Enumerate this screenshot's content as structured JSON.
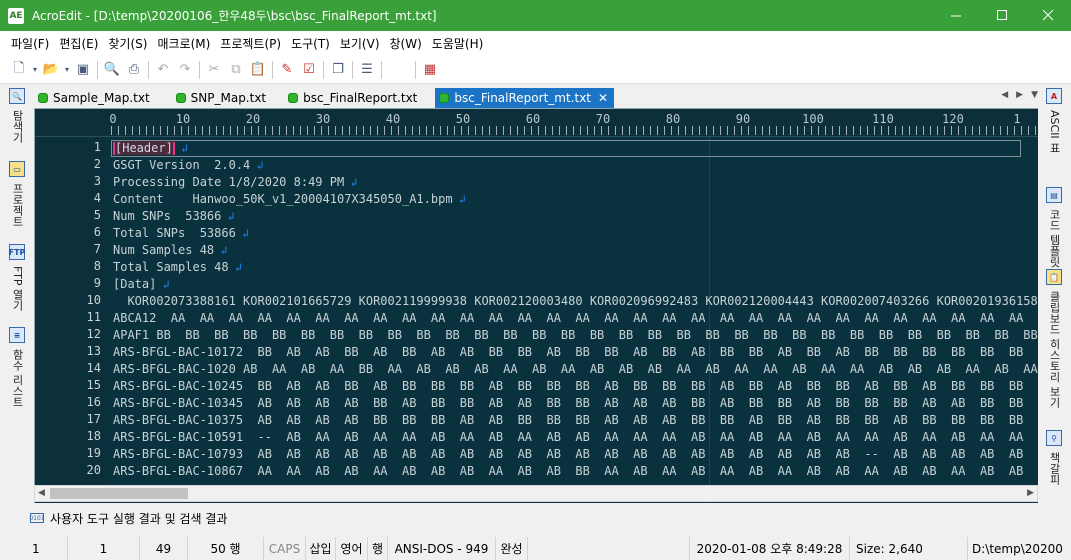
{
  "window": {
    "title": "AcroEdit - [D:\\temp\\20200106_한우48두\\bsc\\bsc_FinalReport_mt.txt]",
    "icon_text": "AE",
    "controls": [
      "minimize-icon",
      "maximize-icon",
      "close-icon"
    ]
  },
  "menu": [
    "파일(F)",
    "편집(E)",
    "찾기(S)",
    "매크로(M)",
    "프로젝트(P)",
    "도구(T)",
    "보기(V)",
    "창(W)",
    "도움말(H)"
  ],
  "toolbar": {
    "icons": [
      "new-file-icon",
      "dropdown-icon",
      "open-folder-icon",
      "dropdown-icon",
      "save-icon",
      "print-preview-icon",
      "print-icon",
      "undo-icon",
      "redo-icon",
      "cut-icon",
      "copy-icon",
      "paste-icon",
      "bookmark-icon",
      "bookmark-list-icon",
      "window-icon",
      "column-mode-icon",
      "calendar-icon"
    ]
  },
  "left_panel": [
    {
      "label": "탐색기",
      "icon": "explorer-icon"
    },
    {
      "label": "프로젝트",
      "icon": "project-icon"
    },
    {
      "label": "FTP 열기",
      "icon": "ftp-icon"
    },
    {
      "label": "함수 리스트",
      "icon": "function-list-icon"
    }
  ],
  "right_panel": [
    {
      "label": "ASCII 표",
      "icon": "ascii-table-icon"
    },
    {
      "label": "코드 템플릿",
      "icon": "code-template-icon"
    },
    {
      "label": "클립보드 히스토리 보기",
      "icon": "clipboard-icon"
    },
    {
      "label": "책갈피",
      "icon": "bookmark-panel-icon"
    }
  ],
  "tabs": [
    {
      "label": "Sample_Map.txt",
      "active": false
    },
    {
      "label": "SNP_Map.txt",
      "active": false
    },
    {
      "label": "bsc_FinalReport.txt",
      "active": false
    },
    {
      "label": "bsc_FinalReport_mt.txt",
      "active": true
    }
  ],
  "tab_nav": [
    "◀",
    "▶",
    "▼"
  ],
  "ruler": [
    "0",
    "10",
    "20",
    "30",
    "40",
    "50",
    "60",
    "70",
    "80",
    "90",
    "100",
    "110",
    "120",
    "1"
  ],
  "lines": [
    {
      "n": "1",
      "text": "[Header]"
    },
    {
      "n": "2",
      "text": "GSGT Version  2.0.4"
    },
    {
      "n": "3",
      "text": "Processing Date 1/8/2020 8:49 PM"
    },
    {
      "n": "4",
      "text": "Content    Hanwoo_50K_v1_20004107X345050_A1.bpm"
    },
    {
      "n": "5",
      "text": "Num SNPs  53866"
    },
    {
      "n": "6",
      "text": "Total SNPs  53866"
    },
    {
      "n": "7",
      "text": "Num Samples 48"
    },
    {
      "n": "8",
      "text": "Total Samples 48"
    },
    {
      "n": "9",
      "text": "[Data]"
    },
    {
      "n": "10",
      "text": "  KOR002073388161 KOR002101665729 KOR002119999938 KOR002120003480 KOR002096992483 KOR002120004443 KOR002007403266 KOR002019361583 KO"
    },
    {
      "n": "11",
      "text": "ABCA12  AA  AA  AA  AA  AA  AA  AA  AA  AA  AA  AA  AA  AA  AA  AA  AA  AA  AA  AA  AA  AA  AA  AA  AA  AA  AA  AA  AA  AA  AA  AA  AA  AA  AA  AA  AA"
    },
    {
      "n": "12",
      "text": "APAF1 BB  BB  BB  BB  BB  BB  BB  BB  BB  BB  BB  BB  BB  BB  BB  BB  BB  BB  BB  BB  BB  BB  BB  BB  BB  BB  BB  BB  BB  BB  BB  BB  BB  BB  BB  BB"
    },
    {
      "n": "13",
      "text": "ARS-BFGL-BAC-10172  BB  AB  AB  BB  AB  BB  AB  AB  BB  BB  AB  BB  BB  AB  BB  AB  BB  BB  AB  BB  AB  BB  BB  BB  BB  BB  BB  BB  BB  BB"
    },
    {
      "n": "14",
      "text": "ARS-BFGL-BAC-1020 AB  AA  AB  AA  BB  AA  AB  AB  AB  AA  AB  AA  AB  AB  AB  AA  AB  AA  AA  AB  AA  AA  AB  AB  AB  AA  AB  AA  AA  AB"
    },
    {
      "n": "15",
      "text": "ARS-BFGL-BAC-10245  BB  AB  AB  BB  AB  BB  BB  BB  AB  BB  BB  BB  AB  BB  BB  BB  AB  BB  AB  BB  BB  AB  BB  AB  BB  BB  BB  BB  BB  BB"
    },
    {
      "n": "16",
      "text": "ARS-BFGL-BAC-10345  AB  AB  AB  AB  BB  AB  BB  BB  AB  AB  BB  BB  AB  AB  AB  BB  AB  BB  BB  AB  BB  BB  BB  AB  AB  BB  BB  AB  BB  AA"
    },
    {
      "n": "17",
      "text": "ARS-BFGL-BAC-10375  AB  AB  AB  AB  BB  BB  BB  AB  AB  BB  BB  BB  AB  AB  AB  BB  BB  AB  BB  AB  BB  BB  AB  BB  BB  BB  BB  BB  BB  BB"
    },
    {
      "n": "18",
      "text": "ARS-BFGL-BAC-10591  --  AB  AA  AB  AA  AA  AB  AA  AB  AA  AB  AB  AA  AA  AA  AB  AA  AB  AA  AB  AA  AA  AB  AA  AB  AA  AA  AB  AA  AB"
    },
    {
      "n": "19",
      "text": "ARS-BFGL-BAC-10793  AB  AB  AB  AB  AB  AB  AB  AB  AB  AB  AB  AB  AB  AB  AB  AB  AB  AB  AB  AB  AB  --  AB  AB  AB  AB  AB  AB  AB  BB"
    },
    {
      "n": "20",
      "text": "ARS-BFGL-BAC-10867  AA  AA  AB  AB  AA  AB  AB  AB  AA  AB  AB  BB  AA  AB  AA  AB  AA  AB  AA  AB  AB  AA  AB  AB  AA  AB  AB  AB  BB  AB"
    }
  ],
  "output_panel": {
    "label": "사용자 도구 실행 결과 및 검색 결과",
    "icon": "output-icon"
  },
  "status": [
    "1",
    "1",
    "49",
    "50 행",
    "CAPS",
    "삽입",
    "영어",
    "행",
    "ANSI-DOS - 949",
    "완성",
    "",
    "2020-01-08 오후 8:49:28",
    "Size: 2,640",
    "D:\\temp\\20200"
  ],
  "colors": {
    "titlebar": "#3aa03a",
    "editor_bg": "#09323e",
    "active_tab": "#1c74c6",
    "line_end_marker": "#1f86ff"
  }
}
